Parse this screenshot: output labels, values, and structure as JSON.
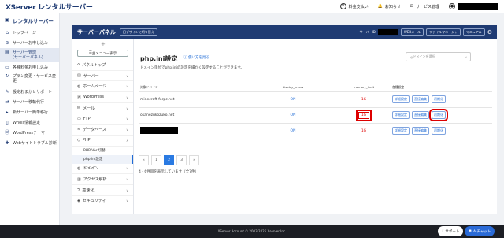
{
  "brand": "XServer レンタルサーバー",
  "topnav": {
    "pay": "料金支払い",
    "notice": "お知らせ",
    "services": "サービス管理"
  },
  "leftnav": {
    "heading": "レンタルサーバー",
    "items": [
      "トップページ",
      "サーバーお申し込み",
      "サーバー管理\n(サーバーパネル)",
      "各種料金お申し込み",
      "プラン変更・サービス変更",
      "設定おまかせサポート",
      "サーバー移転代行",
      "新サーバー簡単移行",
      "Whois情報設定",
      "WordPressテーマ",
      "Webサイトトラブル診断"
    ]
  },
  "panel": {
    "title": "サーバーパネル",
    "new_design": "旧デザインに切り替え",
    "server_id_label": "サーバーID",
    "webmail": "WEBメール",
    "file_manager": "ファイルマネージャ",
    "manual": "マニュアル"
  },
  "sidepanel": {
    "main_menu": "主メニュー表示",
    "items": [
      "パネルトップ",
      "サーバー",
      "ホームページ",
      "WordPress",
      "メール",
      "FTP",
      "データベース",
      "PHP"
    ],
    "php_subs": [
      "PHP Ver.切替",
      "php.ini設定"
    ],
    "items2": [
      "ドメイン",
      "アクセス解析",
      "高速化",
      "セキュリティ"
    ]
  },
  "content": {
    "title": "php.ini設定",
    "howto": "使い方を見る",
    "description": "ドメイン単位でphp.iniの設定を細かく設定することができます。",
    "domain_select_placeholder": "ドメインを選択",
    "columns": [
      "対象ドメイン",
      "display_errors",
      "memory_limit",
      "各種設定"
    ],
    "rows": [
      {
        "domain": "minecraft-forpc.net",
        "display_errors": "ON",
        "memory_limit": "1G"
      },
      {
        "domain": "okanezukozuko.net",
        "display_errors": "ON",
        "memory_limit": "1G"
      },
      {
        "domain": "",
        "display_errors": "ON",
        "memory_limit": "1G"
      }
    ],
    "btn_detail": "詳細設定",
    "btn_direct": "直接編集",
    "btn_init": "初期化",
    "pager": [
      "«",
      "1",
      "2",
      "3",
      "»"
    ],
    "count": "4 - 6件目を表示しています（全7件）"
  },
  "footer": {
    "copyright": "XServer Account © 2003-2025 Xserver Inc.",
    "support": "サポート",
    "ai_chat": "AIチャット"
  }
}
